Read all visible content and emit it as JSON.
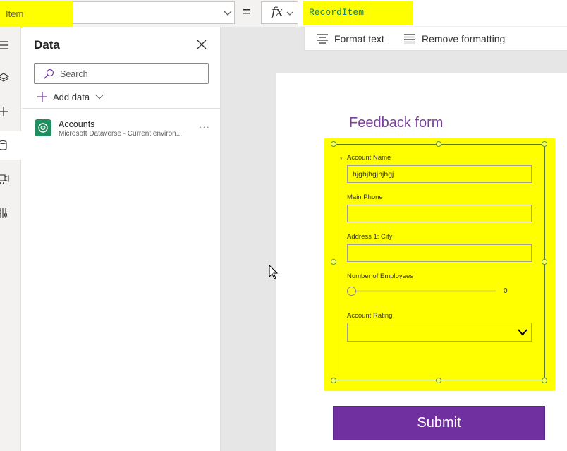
{
  "formula_bar": {
    "property": "Item",
    "equals": "=",
    "fx": "fx",
    "formula": "RecordItem",
    "format_text": "Format text",
    "remove_formatting": "Remove formatting"
  },
  "rail": {
    "icons": [
      "hamburger-icon",
      "layers-icon",
      "add-icon",
      "database-icon",
      "media-icon",
      "tools-icon"
    ]
  },
  "data_panel": {
    "title": "Data",
    "search_placeholder": "Search",
    "add_data": "Add data",
    "sources": [
      {
        "name": "Accounts",
        "subtitle": "Microsoft Dataverse - Current environ...",
        "more": "···"
      }
    ]
  },
  "form": {
    "title": "Feedback form",
    "required_marker": "*",
    "fields": {
      "account_name": {
        "label": "Account Name",
        "value": "hjghjhgjhjhgj"
      },
      "main_phone": {
        "label": "Main Phone",
        "value": ""
      },
      "city": {
        "label": "Address 1: City",
        "value": ""
      },
      "employees": {
        "label": "Number of Employees",
        "value": "0"
      },
      "rating": {
        "label": "Account Rating",
        "value": ""
      }
    },
    "submit": "Submit"
  },
  "colors": {
    "highlight": "#ffff00",
    "accent_purple": "#7030a0",
    "formula_green": "#16825d",
    "title_purple": "#7b3fa0"
  }
}
